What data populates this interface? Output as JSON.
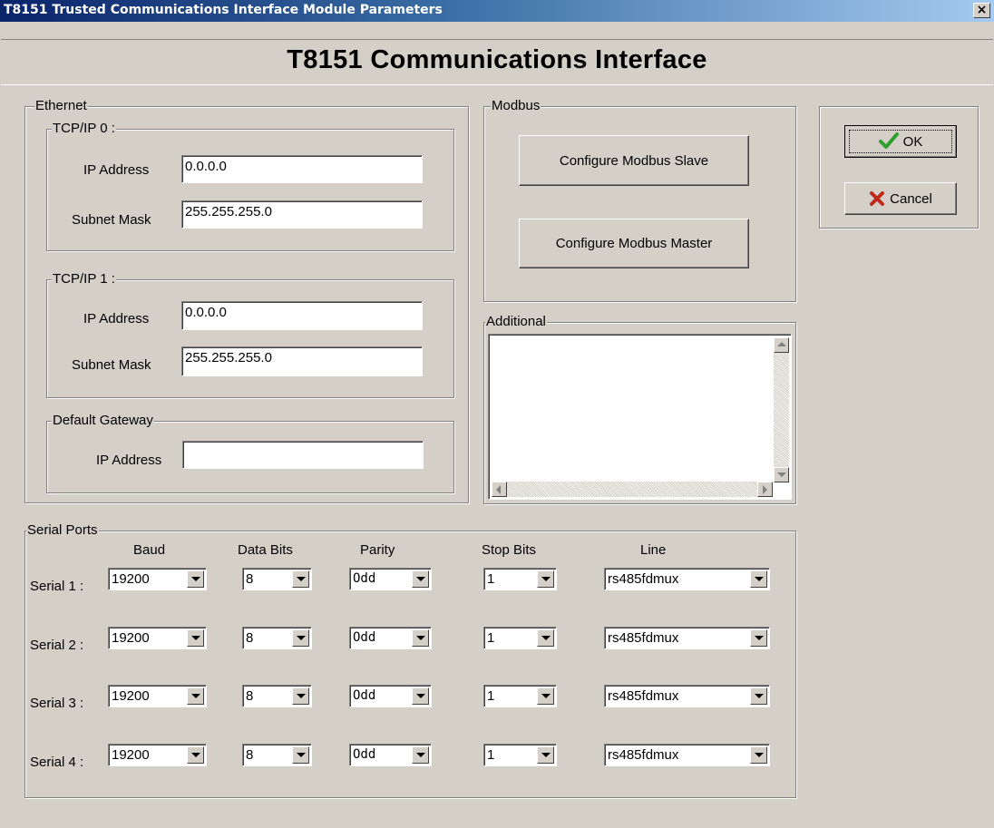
{
  "window": {
    "title": "T8151 Trusted Communications Interface Module Parameters",
    "close_glyph": "×"
  },
  "header": {
    "title": "T8151 Communications Interface"
  },
  "ethernet": {
    "label": "Ethernet",
    "tcpip0": {
      "label": "TCP/IP 0 :",
      "ip_label": "IP Address",
      "ip_value": "0.0.0.0",
      "mask_label": "Subnet Mask",
      "mask_value": "255.255.255.0"
    },
    "tcpip1": {
      "label": "TCP/IP 1 :",
      "ip_label": "IP Address",
      "ip_value": "0.0.0.0",
      "mask_label": "Subnet Mask",
      "mask_value": "255.255.255.0"
    },
    "gateway": {
      "label": "Default Gateway",
      "ip_label": "IP Address",
      "ip_value": ""
    }
  },
  "modbus": {
    "label": "Modbus",
    "slave_button": "Configure Modbus Slave",
    "master_button": "Configure Modbus Master"
  },
  "additional": {
    "label": "Additional",
    "text": ""
  },
  "actions": {
    "ok": "OK",
    "cancel": "Cancel",
    "ok_icon": "checkmark-icon",
    "cancel_icon": "x-icon"
  },
  "serial": {
    "label": "Serial Ports",
    "headers": {
      "baud": "Baud",
      "data_bits": "Data Bits",
      "parity": "Parity",
      "stop_bits": "Stop Bits",
      "line": "Line"
    },
    "ports": [
      {
        "label": "Serial 1 :",
        "baud": "19200",
        "data_bits": "8",
        "parity": "Odd",
        "stop_bits": "1",
        "line": "rs485fdmux"
      },
      {
        "label": "Serial 2 :",
        "baud": "19200",
        "data_bits": "8",
        "parity": "Odd",
        "stop_bits": "1",
        "line": "rs485fdmux"
      },
      {
        "label": "Serial 3 :",
        "baud": "19200",
        "data_bits": "8",
        "parity": "Odd",
        "stop_bits": "1",
        "line": "rs485fdmux"
      },
      {
        "label": "Serial 4 :",
        "baud": "19200",
        "data_bits": "8",
        "parity": "Odd",
        "stop_bits": "1",
        "line": "rs485fdmux"
      }
    ]
  },
  "colors": {
    "ok_check": "#2e9e2e",
    "cancel_x": "#c0281c",
    "titlebar_start": "#0a246a",
    "titlebar_end": "#a6caf0"
  }
}
